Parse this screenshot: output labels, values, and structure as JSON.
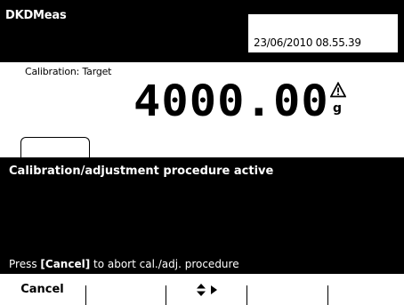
{
  "header": {
    "app_title": "DKDMeas",
    "datetime": "23/06/2010 08.55.39"
  },
  "reading": {
    "label": "Calibration: Target",
    "value": "4000.00",
    "unit": "g",
    "status_icon": "warning-triangle-icon"
  },
  "message": {
    "title": "Calibration/adjustment procedure active",
    "hint_prefix": "Press ",
    "hint_key_open": "[",
    "hint_key": "Cancel",
    "hint_key_close": "]",
    "hint_suffix": " to abort cal./adj. procedure"
  },
  "softkeys": [
    {
      "label": "Cancel",
      "icon": ""
    },
    {
      "label": "",
      "icon": ""
    },
    {
      "label": "",
      "icon": "up-down-right-arrows-icon"
    },
    {
      "label": "",
      "icon": ""
    },
    {
      "label": "",
      "icon": ""
    }
  ],
  "colors": {
    "background": "#ffffff",
    "panel": "#000000",
    "text_on_panel": "#ffffff"
  }
}
